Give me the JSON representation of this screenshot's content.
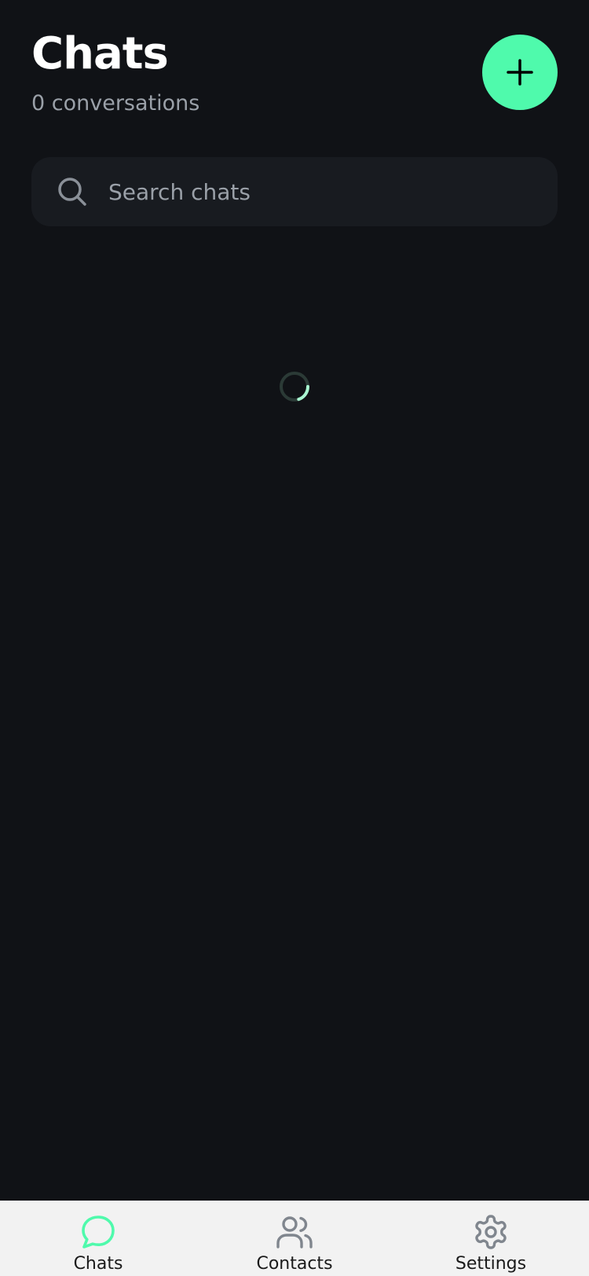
{
  "header": {
    "title": "Chats",
    "subtitle": "0 conversations"
  },
  "new_chat_button": {
    "icon": "plus-icon"
  },
  "search": {
    "placeholder": "Search chats",
    "value": "",
    "icon": "search-icon"
  },
  "status": {
    "loading": true
  },
  "tabbar": {
    "tabs": [
      {
        "label": "Chats",
        "icon": "chat-bubble-icon",
        "active": true
      },
      {
        "label": "Contacts",
        "icon": "users-icon",
        "active": false
      },
      {
        "label": "Settings",
        "icon": "gear-icon",
        "active": false
      }
    ]
  },
  "colors": {
    "background": "#101216",
    "accent": "#4ffaac",
    "search_bg": "#181b20",
    "muted_text": "#9aa0a8",
    "tabbar_bg": "#f2f2f2",
    "inactive_icon": "#80868e"
  }
}
